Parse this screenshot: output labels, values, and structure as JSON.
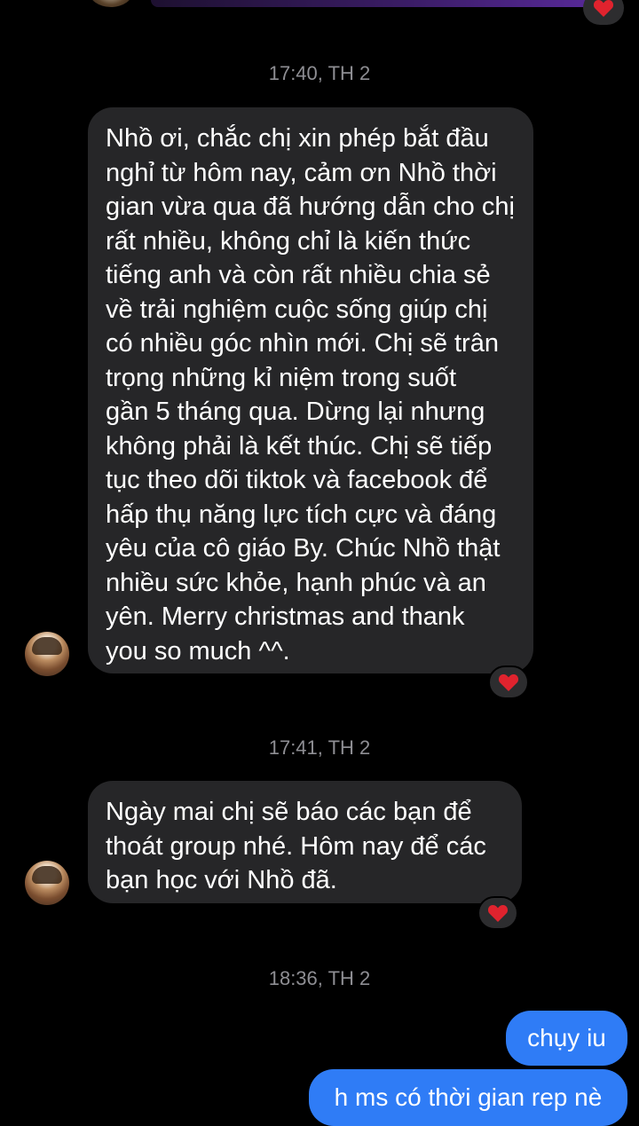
{
  "colors": {
    "background": "#000000",
    "incoming_bubble": "#262628",
    "outgoing_bubble": "#2f7cf6",
    "timestamp": "#8e8e93",
    "reaction_heart": "#e0232e"
  },
  "messages": [
    {
      "timestamp": "17:40, TH 2",
      "sender": "incoming",
      "lines": [
        "Nhồ ơi, chắc chị xin phép bắt đầu",
        "nghỉ từ hôm nay, cảm ơn Nhồ thời",
        "gian vừa qua đã hướng dẫn cho chị",
        "rất nhiều, không chỉ là kiến thức",
        "tiếng anh và còn rất nhiều chia sẻ",
        "về trải nghiệm cuộc sống giúp chị",
        "có nhiều góc nhìn mới. Chị sẽ trân",
        "trọng những kỉ niệm trong suốt",
        "gần 5 tháng qua. Dừng lại nhưng",
        "không phải là kết thúc. Chị sẽ tiếp",
        "tục theo dõi tiktok và facebook để",
        "hấp thụ năng lực tích cực và đáng",
        "yêu của cô giáo By. Chúc Nhồ thật",
        "nhiều sức khỏe, hạnh phúc và an",
        "yên. Merry christmas and thank",
        "you so much ^^."
      ],
      "reaction_icon": "red-heart-icon"
    },
    {
      "timestamp": "17:41, TH 2",
      "sender": "incoming",
      "lines": [
        "Ngày mai chị sẽ báo các bạn để",
        "thoát group nhé. Hôm nay để các",
        "bạn học với Nhồ đã."
      ],
      "reaction_icon": "red-heart-icon"
    },
    {
      "timestamp": "18:36, TH 2",
      "sender": "outgoing",
      "lines": [
        "chụy iu",
        "h ms có thời gian rep nè"
      ]
    }
  ]
}
